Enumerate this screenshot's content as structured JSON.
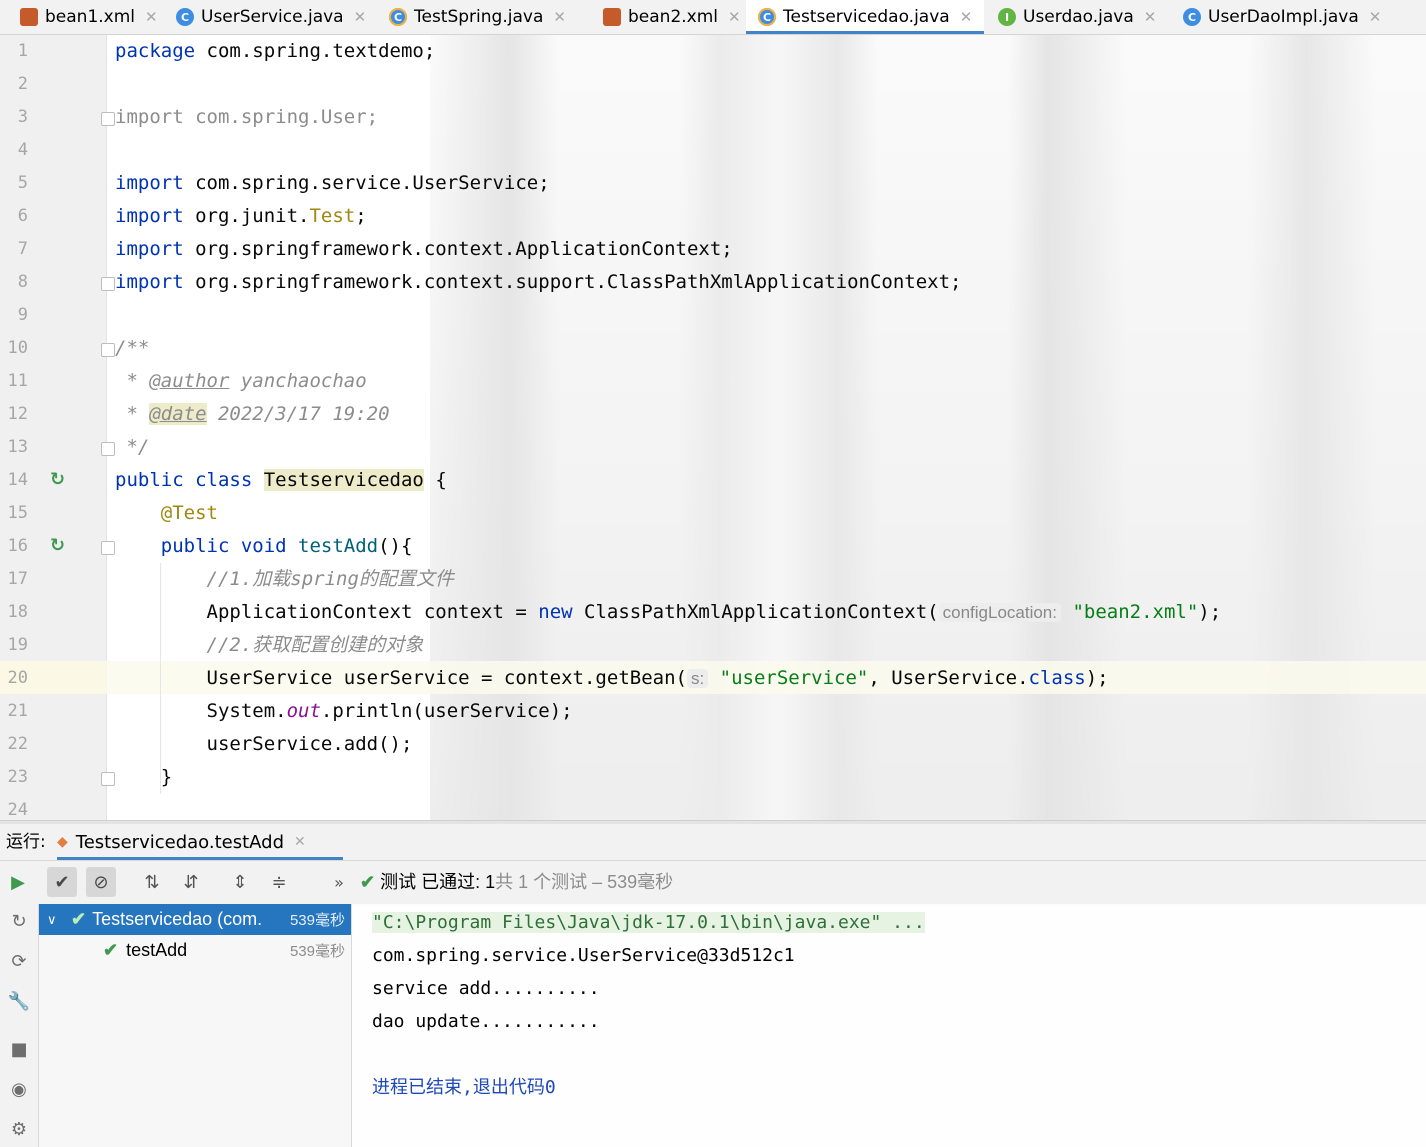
{
  "tabs": [
    {
      "label": "bean1.xml",
      "icon": "xml-file-icon"
    },
    {
      "label": "UserService.java",
      "icon": "class-icon"
    },
    {
      "label": "TestSpring.java",
      "icon": "test-class-icon"
    },
    {
      "label": "bean2.xml",
      "icon": "xml-file-icon"
    },
    {
      "label": "Testservicedao.java",
      "icon": "test-class-icon",
      "active": true
    },
    {
      "label": "Userdao.java",
      "icon": "interface-icon"
    },
    {
      "label": "UserDaoImpl.java",
      "icon": "class-icon"
    }
  ],
  "editor": {
    "line_numbers": [
      "1",
      "2",
      "3",
      "4",
      "5",
      "6",
      "7",
      "8",
      "9",
      "10",
      "11",
      "12",
      "13",
      "14",
      "15",
      "16",
      "17",
      "18",
      "19",
      "20",
      "21",
      "22",
      "23",
      "24"
    ],
    "current_line": "20",
    "code": {
      "l1_kw": "package",
      "l1_rest": " com.spring.textdemo;",
      "l3": "import com.spring.User;",
      "l5_kw": "import",
      "l5_rest": " com.spring.service.UserService;",
      "l6_kw": "import",
      "l6_rest": " org.junit.",
      "l6_cls": "Test",
      "l6_end": ";",
      "l7_kw": "import",
      "l7_rest": " org.springframework.context.ApplicationContext;",
      "l8_kw": "import",
      "l8_rest": " org.springframework.context.support.ClassPathXmlApplicationContext;",
      "l10": "/**",
      "l11_star": " * ",
      "l11_tag": "@author",
      "l11_val": " yanchaochao",
      "l12_star": " * ",
      "l12_tag": "@date",
      "l12_val": " 2022/3/17 19:20",
      "l13": " */",
      "l14_kw": "public class ",
      "l14_cls": "Testservicedao",
      "l14_end": " {",
      "l15": "    @Test",
      "l16_kw": "    public void ",
      "l16_fn": "testAdd",
      "l16_end": "(){",
      "l17": "        //1.加载spring的配置文件",
      "l18_a": "        ApplicationContext context = ",
      "l18_kw": "new",
      "l18_b": " ClassPathXmlApplicationContext(",
      "l18_hint": "configLocation:",
      "l18_str": "\"bean2.xml\"",
      "l18_end": ");",
      "l19": "        //2.获取配置创建的对象",
      "l20_a": "        UserService userService = context.getBean(",
      "l20_hint": "s:",
      "l20_str": "\"userService\"",
      "l20_b": ", UserService.",
      "l20_kw": "class",
      "l20_end": ");",
      "l21_a": "        System.",
      "l21_fld": "out",
      "l21_b": ".println(userService);",
      "l22": "        userService.add();",
      "l23": "    }"
    }
  },
  "run_panel": {
    "label": "运行:",
    "tab": "Testservicedao.testAdd",
    "status_prefix": "测试 已通过: 1",
    "status_suffix": "共 1 个测试 – 539毫秒",
    "tree": [
      {
        "label": "Testservicedao (com.",
        "time": "539毫秒"
      },
      {
        "label": "testAdd",
        "time": "539毫秒"
      }
    ],
    "console": [
      "\"C:\\Program Files\\Java\\jdk-17.0.1\\bin\\java.exe\" ...",
      "com.spring.service.UserService@33d512c1",
      "service add..........",
      "dao update..........."
    ],
    "exit_message": "进程已结束,退出代码0"
  },
  "colors": {
    "accent": "#4083c9",
    "selection": "#2675bf",
    "pass": "#3f9a50"
  }
}
